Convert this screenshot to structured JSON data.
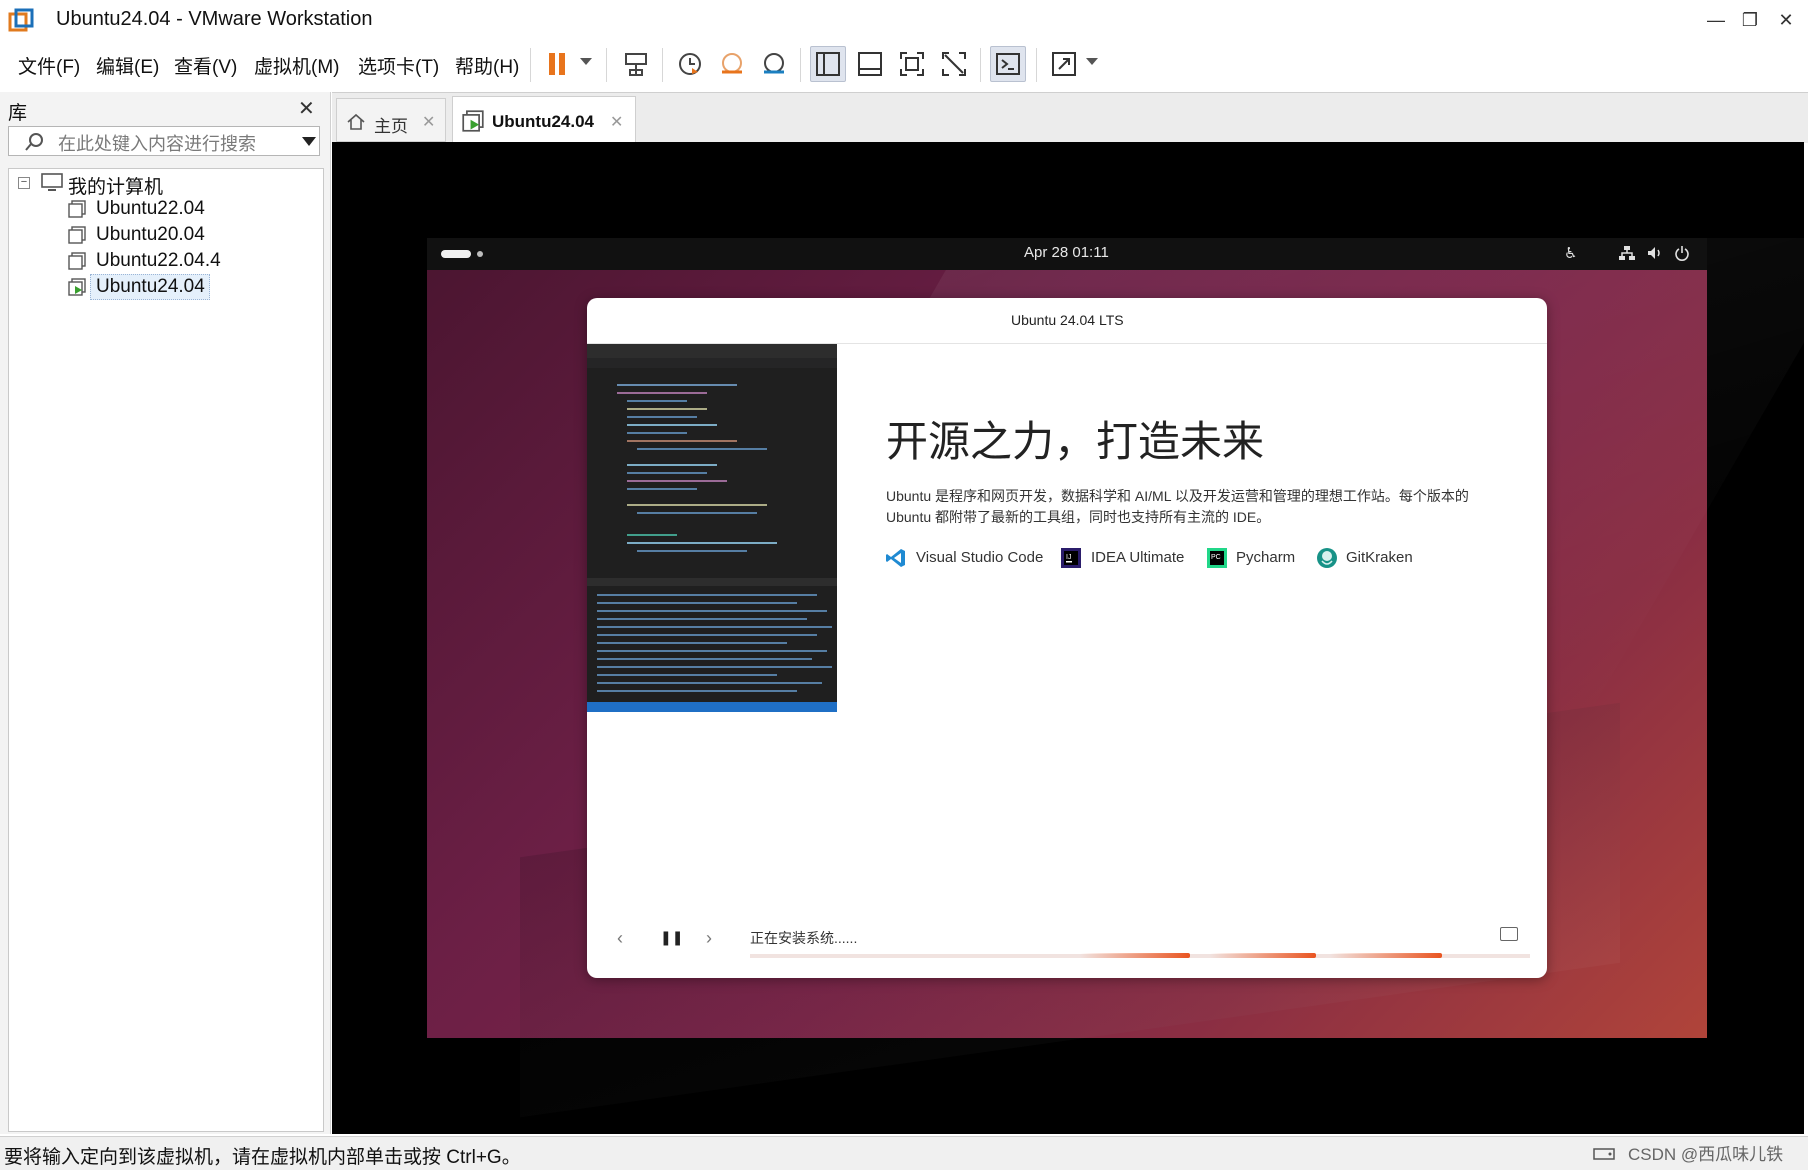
{
  "window": {
    "title": "Ubuntu24.04 - VMware Workstation",
    "minimize_glyph": "—",
    "restore_glyph": "❐",
    "close_glyph": "✕"
  },
  "menu": {
    "file": "文件(F)",
    "edit": "编辑(E)",
    "view": "查看(V)",
    "vm": "虚拟机(M)",
    "tabs": "选项卡(T)",
    "help": "帮助(H)"
  },
  "library": {
    "title": "库",
    "search_placeholder": "在此处键入内容进行搜索",
    "root": "我的计算机",
    "items": [
      "Ubuntu22.04",
      "Ubuntu20.04",
      "Ubuntu22.04.4",
      "Ubuntu24.04"
    ],
    "selected": "Ubuntu24.04"
  },
  "tabs": [
    {
      "label": "主页",
      "icon": "home-icon"
    },
    {
      "label": "Ubuntu24.04",
      "icon": "vm-running-icon"
    }
  ],
  "guest": {
    "clock": "Apr 28  01:11",
    "installer": {
      "title": "Ubuntu 24.04 LTS",
      "heading": "开源之力，打造未来",
      "description_line1": "Ubuntu 是程序和网页开发，数据科学和 AI/ML 以及开发运营和管理的理想工作站。每个版本的",
      "description_line2": "Ubuntu 都附带了最新的工具组，同时也支持所有主流的 IDE。",
      "tools": [
        "Visual Studio Code",
        "IDEA Ultimate",
        "Pycharm",
        "GitKraken"
      ],
      "status": "正在安装系统......",
      "progress_segments": 3
    }
  },
  "statusbar": {
    "message": "要将输入定向到该虚拟机，请在虚拟机内部单击或按 Ctrl+G。",
    "watermark": "CSDN @西瓜味儿铁"
  },
  "colors": {
    "accent_orange": "#e95420",
    "pause_orange": "#e8741c",
    "vscode_blue": "#1f8ad2",
    "selection": "#e5f0fb"
  }
}
